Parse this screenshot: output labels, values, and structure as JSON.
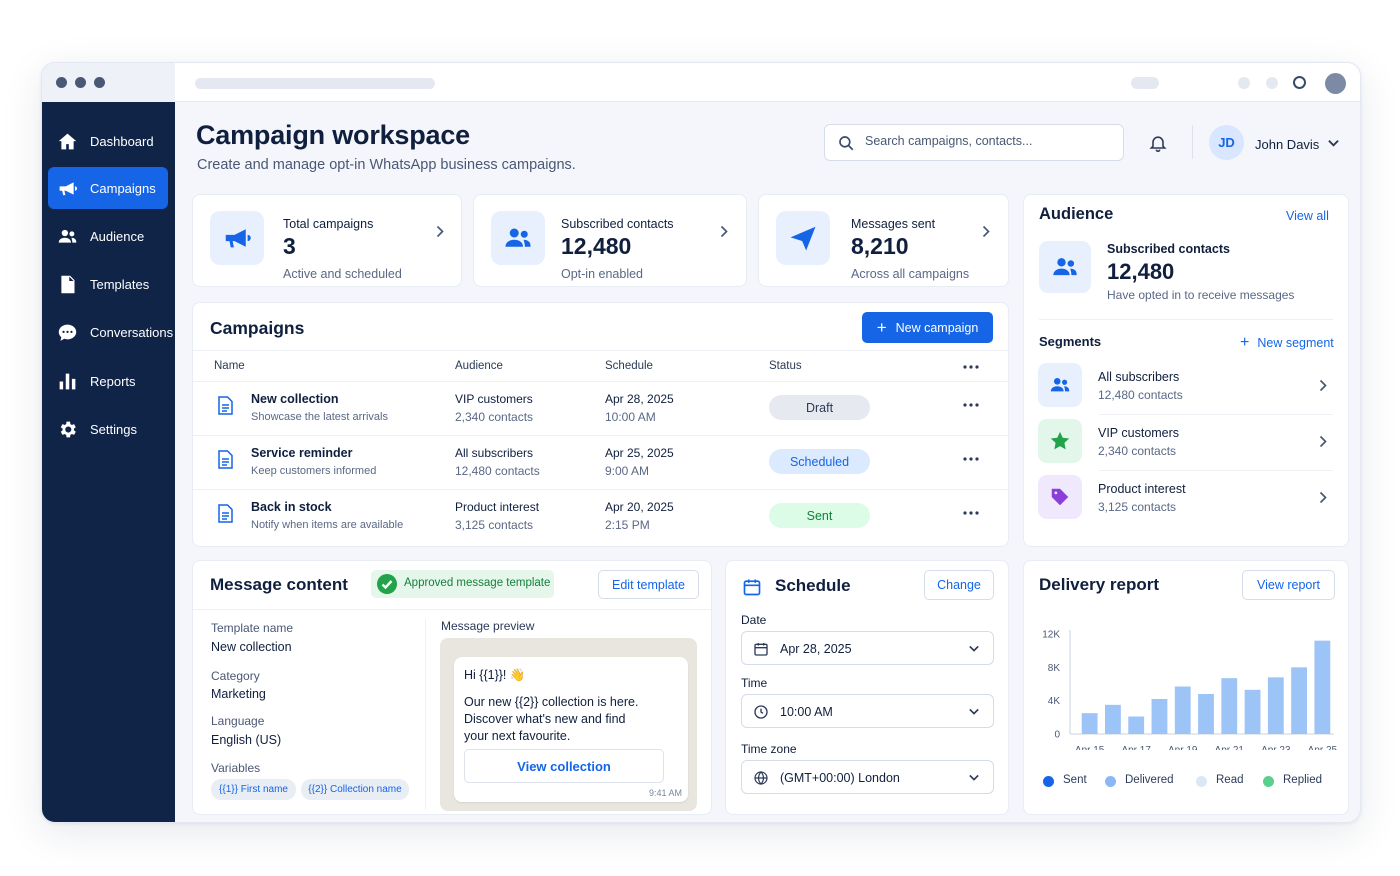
{
  "sidebar": {
    "items": [
      {
        "label": "Dashboard",
        "icon": "home-icon"
      },
      {
        "label": "Campaigns",
        "icon": "megaphone-icon",
        "active": true
      },
      {
        "label": "Audience",
        "icon": "users-icon"
      },
      {
        "label": "Templates",
        "icon": "document-icon"
      },
      {
        "label": "Conversations",
        "icon": "chat-icon"
      },
      {
        "label": "Reports",
        "icon": "bar-chart-icon"
      },
      {
        "label": "Settings",
        "icon": "gear-icon"
      }
    ]
  },
  "header": {
    "title": "Campaign workspace",
    "subtitle": "Create and manage opt-in WhatsApp business campaigns.",
    "search_placeholder": "Search campaigns, contacts...",
    "user_initials": "JD",
    "user_name": "John Davis"
  },
  "stats": [
    {
      "label": "Total campaigns",
      "value": "3",
      "sub": "Active and scheduled",
      "icon": "megaphone-icon"
    },
    {
      "label": "Subscribed contacts",
      "value": "12,480",
      "sub": "Opt-in enabled",
      "icon": "users-icon"
    },
    {
      "label": "Messages sent",
      "value": "8,210",
      "sub": "Across all campaigns",
      "icon": "send-icon"
    }
  ],
  "campaigns": {
    "title": "Campaigns",
    "new_button": "New campaign",
    "columns": [
      "Name",
      "Audience",
      "Schedule",
      "Status"
    ],
    "rows": [
      {
        "name": "New collection",
        "desc": "Showcase the latest arrivals",
        "audience": "VIP customers",
        "audience_count": "2,340 contacts",
        "date": "Apr 28, 2025",
        "time": "10:00 AM",
        "status": "Draft"
      },
      {
        "name": "Service reminder",
        "desc": "Keep customers informed",
        "audience": "All subscribers",
        "audience_count": "12,480 contacts",
        "date": "Apr 25, 2025",
        "time": "9:00 AM",
        "status": "Scheduled"
      },
      {
        "name": "Back in stock",
        "desc": "Notify when items are available",
        "audience": "Product interest",
        "audience_count": "3,125 contacts",
        "date": "Apr 20, 2025",
        "time": "2:15 PM",
        "status": "Sent"
      }
    ]
  },
  "status_colors": {
    "Draft": "#e6e9ef",
    "Scheduled": "#dbeafe",
    "Sent": "#dcfce7"
  },
  "audience": {
    "title": "Audience",
    "view_all": "View all",
    "summary_label": "Subscribed contacts",
    "summary_value": "12,480",
    "summary_sub": "Have opted in to receive messages",
    "segments_title": "Segments",
    "new_segment": "New segment",
    "segments": [
      {
        "name": "All subscribers",
        "count": "12,480 contacts",
        "icon": "users-icon"
      },
      {
        "name": "VIP customers",
        "count": "2,340 contacts",
        "icon": "star-icon"
      },
      {
        "name": "Product interest",
        "count": "3,125 contacts",
        "icon": "tag-icon"
      }
    ]
  },
  "message": {
    "title": "Message content",
    "badge": "Approved message template",
    "edit_button": "Edit template",
    "template_name_label": "Template name",
    "template_name": "New collection",
    "category_label": "Category",
    "category": "Marketing",
    "language_label": "Language",
    "language": "English (US)",
    "variables_label": "Variables",
    "variables": [
      "{{1}} First name",
      "{{2}} Collection name"
    ],
    "preview_label": "Message preview",
    "preview_greeting": "Hi {{1}}! 👋",
    "preview_body": "Our new {{2}} collection is here. Discover what's new and find your next favourite.",
    "preview_button": "View collection",
    "preview_time": "9:41 AM"
  },
  "schedule": {
    "title": "Schedule",
    "change_button": "Change",
    "date_label": "Date",
    "date": "Apr 28, 2025",
    "time_label": "Time",
    "time": "10:00 AM",
    "timezone_label": "Time zone",
    "timezone": "(GMT+00:00) London"
  },
  "delivery": {
    "title": "Delivery report",
    "view_button": "View report"
  },
  "chart_data": {
    "type": "bar",
    "title": "Delivery report",
    "x_tick_labels": [
      "Apr 15",
      "Apr 17",
      "Apr 19",
      "Apr 21",
      "Apr 23",
      "Apr 25"
    ],
    "y_tick_labels": [
      "12K",
      "8K",
      "4K",
      "0"
    ],
    "ylim": [
      0,
      12000
    ],
    "values": [
      2500,
      3500,
      2100,
      4200,
      5700,
      4800,
      6700,
      5300,
      6800,
      8000,
      11200
    ],
    "legend": [
      "Sent",
      "Delivered",
      "Read",
      "Replied"
    ],
    "legend_colors": [
      "#1565e6",
      "#8bb8f5",
      "#dbe6f7",
      "#5bcf8c"
    ],
    "bar_color": "#9cc4f7",
    "grid": false,
    "legend_position": "bottom"
  }
}
